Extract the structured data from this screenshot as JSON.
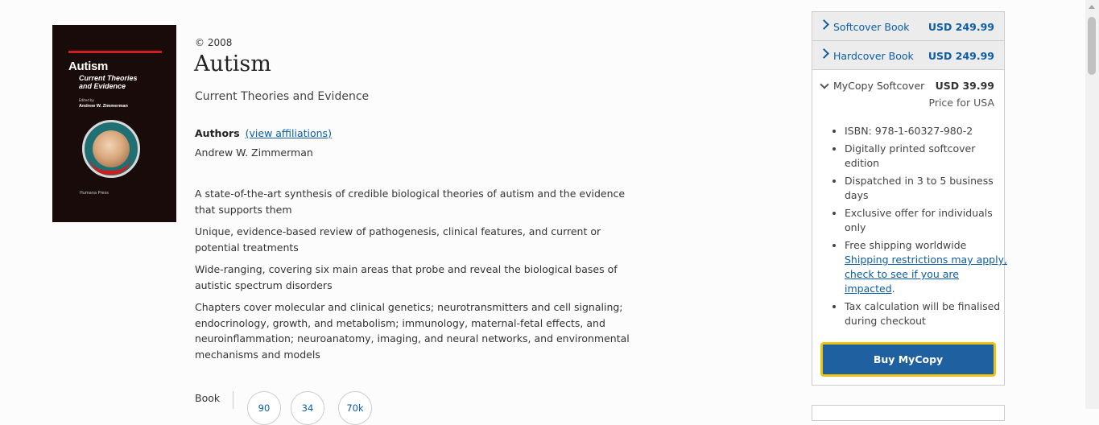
{
  "cover": {
    "title": "Autism",
    "subtitle_line1": "Current Theories",
    "subtitle_line2": "and Evidence",
    "edited_by": "Edited by",
    "author": "Andrew W. Zimmerman",
    "publisher": "Humana Press"
  },
  "book": {
    "copyright": "© 2008",
    "title": "Autism",
    "subtitle": "Current Theories and Evidence",
    "authors_label": "Authors",
    "affiliations_link": "(view affiliations)",
    "author_name": "Andrew W. Zimmerman",
    "highlights": [
      "A state-of-the-art synthesis of credible biological theories of autism and the evidence that supports them",
      "Unique, evidence-based review of pathogenesis, clinical features, and current or potential treatments",
      "Wide-ranging, covering six main areas that probe and reveal the biological bases of autistic spectrum disorders",
      "Chapters cover molecular and clinical genetics; neurotransmitters and cell signaling; endocrinology, growth, and metabolism; immunology, maternal-fetal effects, and neuroinflammation; neuroanatomy, imaging, and neural networks, and environmental mechanisms and models"
    ],
    "type_label": "Book",
    "metrics": [
      "90",
      "34",
      "70k"
    ]
  },
  "purchase": {
    "options": [
      {
        "label": "Softcover Book",
        "price": "USD 249.99"
      },
      {
        "label": "Hardcover Book",
        "price": "USD 249.99"
      }
    ],
    "mycopy": {
      "label": "MyCopy Softcover",
      "price": "USD 39.99",
      "price_for": "Price for USA",
      "features": {
        "isbn": "ISBN: 978-1-60327-980-2",
        "printed": "Digitally printed softcover edition",
        "dispatch": "Dispatched in 3 to 5 business days",
        "exclusive": "Exclusive offer for individuals only",
        "shipping": "Free shipping worldwide",
        "shipping_link": "Shipping restrictions may apply, check to see if you are impacted",
        "shipping_end": ".",
        "tax": "Tax calculation will be finalised during checkout"
      },
      "buy_label": "Buy MyCopy"
    }
  },
  "colors": {
    "link": "#0c5da5",
    "buy_button": "#1e60a0",
    "focus_ring": "#f0c30f"
  }
}
